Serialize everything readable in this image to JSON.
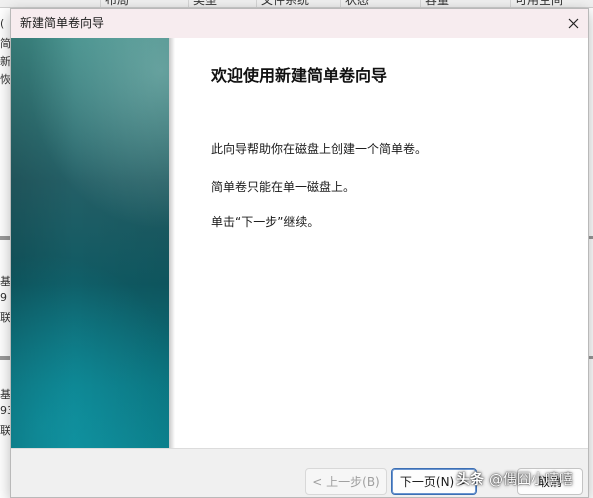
{
  "background_app": {
    "columns": [
      "布局",
      "类型",
      "文件系统",
      "状态",
      "容量",
      "可用空间"
    ],
    "left_fragments": [
      "(",
      "简",
      "新",
      "恢",
      "基",
      "9",
      "联",
      "基",
      "93",
      "联"
    ]
  },
  "dialog": {
    "title": "新建简单卷向导",
    "heading": "欢迎使用新建简单卷向导",
    "paragraphs": [
      "此向导帮助你在磁盘上创建一个简单卷。",
      "简单卷只能在单一磁盘上。",
      "单击“下一步”继续。"
    ],
    "buttons": {
      "back": "< 上一步(B)",
      "next": "下一页(N) >",
      "cancel": "取消"
    }
  },
  "watermark": {
    "brand": "头条",
    "author": "@偶囧小嘻嘻"
  },
  "colors": {
    "titlebar": "#f7ecef",
    "panel_teal": "#0f5a63",
    "footer": "#f0f0f0",
    "primary_border": "#3c6fb4"
  }
}
